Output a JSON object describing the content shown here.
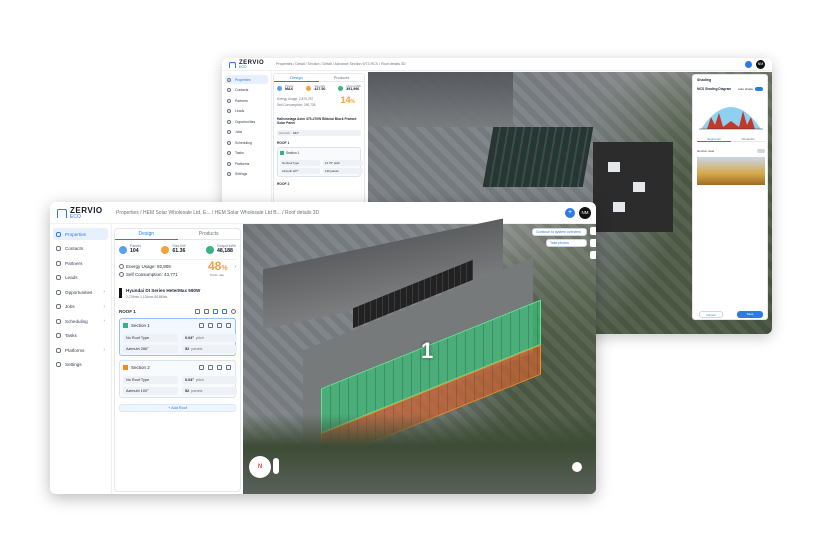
{
  "back_window": {
    "logo": {
      "name": "ZERVIO",
      "sub": "ECO"
    },
    "breadcrumb": "Properties / Detail / Section / Detail / Advance Section 9/73 RCX / Roof details 3D",
    "avatar": "NM",
    "sidebar": [
      {
        "label": "Properties",
        "active": true
      },
      {
        "label": "Contacts"
      },
      {
        "label": "Partners"
      },
      {
        "label": "Leads"
      },
      {
        "label": "Opportunities"
      },
      {
        "label": "Jobs"
      },
      {
        "label": "Scheduling"
      },
      {
        "label": "Tasks"
      },
      {
        "label": "Platforms"
      },
      {
        "label": "Settings"
      }
    ],
    "tabs": [
      "Design",
      "Products"
    ],
    "stats": [
      {
        "label": "Panels",
        "value": "MAX"
      },
      {
        "label": "Size kW",
        "value": "427.50"
      },
      {
        "label": "Output kWh",
        "value": "391,996"
      }
    ],
    "energy_usage_label": "Energy Usage: 2,870,787",
    "self_consumption_label": "Self Consumption: 390,728",
    "percent": "14",
    "percent_unit": "%",
    "product": "Hallsmelaga Asim 475-470W Bifacial Black Framed Solar Panel",
    "azimuth_label": "Azimuth",
    "azimuth_value": "184°",
    "roof": "ROOF 1",
    "section": "Section 1",
    "roof_type": "No Roof Type",
    "pitch": "12.75° pitch",
    "azimuth2": "Azimuth 227°",
    "panels": "149 panels",
    "roof2": "ROOF 2",
    "shading": {
      "title": "Shading",
      "diagram_title": "MCS Shading Diagram",
      "auto_shade": "Auto shade",
      "tabs": [
        "Segments",
        "Obstacles"
      ],
      "horizon": "Horizon view",
      "cancel": "Cancel",
      "save": "Save"
    }
  },
  "front_window": {
    "logo": {
      "name": "ZERVIO",
      "sub": "ECO"
    },
    "breadcrumb": "Properties / HEM Solar Wholesale Ltd, E... / HEM Solar Wholesale Ltd B... / Roof details 3D",
    "avatar": "NM",
    "sidebar": [
      {
        "label": "Properties",
        "active": true,
        "icon": "home-icon"
      },
      {
        "label": "Contacts",
        "icon": "contacts-icon"
      },
      {
        "label": "Partners",
        "icon": "partners-icon"
      },
      {
        "label": "Leads",
        "icon": "leads-icon"
      },
      {
        "label": "Opportunities",
        "icon": "opportunities-icon",
        "chevron": true
      },
      {
        "label": "Jobs",
        "icon": "jobs-icon",
        "chevron": true
      },
      {
        "label": "Scheduling",
        "icon": "calendar-icon",
        "chevron": true
      },
      {
        "label": "Tasks",
        "icon": "tasks-icon"
      },
      {
        "label": "Platforms",
        "icon": "platforms-icon",
        "chevron": true
      },
      {
        "label": "Settings",
        "icon": "gear-icon"
      }
    ],
    "tabs": [
      "Design",
      "Products"
    ],
    "stats": [
      {
        "label": "Panels",
        "value": "104",
        "color": "#5aa0f0"
      },
      {
        "label": "Size kW",
        "value": "61.36",
        "color": "#f2a23a"
      },
      {
        "label": "Output kWh",
        "value": "48,188",
        "color": "#36b37e"
      }
    ],
    "energy_usage": "Energy Usage: 92,909",
    "self_consumption": "Self Consumption: 43,771",
    "percent": "48",
    "percent_unit": "%",
    "percent_caption": "Prodn rate",
    "product": "Hyundai DI Series HeterMax 590W",
    "product_specs": "2,278mm   1,134mm   58.85Wa",
    "roof": "ROOF 1",
    "sections": [
      {
        "name": "Section 1",
        "color": "#36b37e",
        "roof_type": "No Roof Type",
        "pitch": "0.04°",
        "pitch_unit": "pitch",
        "azimuth": "Azimuth 286°",
        "panels": "52",
        "panels_unit": "panels"
      },
      {
        "name": "Section 2",
        "color": "#f08a24",
        "roof_type": "No Roof Type",
        "pitch": "0.04°",
        "pitch_unit": "pitch",
        "azimuth": "Azimuth 100°",
        "panels": "52",
        "panels_unit": "panels"
      }
    ],
    "add_roof": "+ Add Roof",
    "overlay_buttons": [
      "Continue to system overview",
      "Take photos"
    ],
    "compass": "N",
    "roof_label": "1"
  },
  "colors": {
    "accent": "#2c7be5",
    "section1": "#36b37e",
    "section2": "#f08a24"
  }
}
